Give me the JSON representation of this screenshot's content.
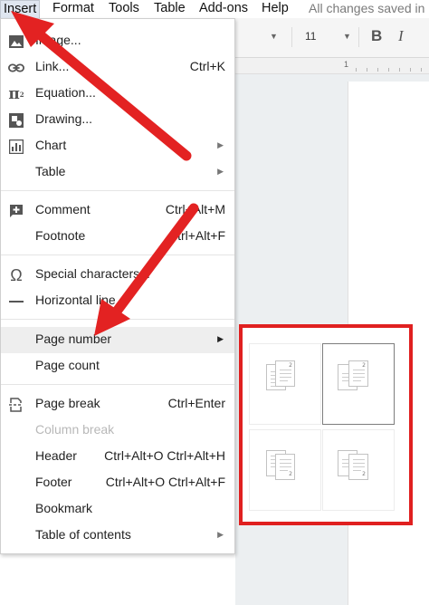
{
  "menubar": {
    "items": [
      "Insert",
      "Format",
      "Tools",
      "Table",
      "Add-ons",
      "Help"
    ],
    "status": "All changes saved in"
  },
  "toolbar": {
    "font_size": "11"
  },
  "ruler": {
    "number": "1"
  },
  "insert_menu": {
    "items": [
      {
        "label": "Image...",
        "icon": "image-icon"
      },
      {
        "label": "Link...",
        "icon": "link-icon",
        "shortcut": "Ctrl+K"
      },
      {
        "label": "Equation...",
        "icon": "pi-icon"
      },
      {
        "label": "Drawing...",
        "icon": "drawing-icon"
      },
      {
        "label": "Chart",
        "icon": "chart-icon",
        "submenu": true
      },
      {
        "label": "Table",
        "submenu": true
      },
      {
        "label": "Comment",
        "icon": "comment-icon",
        "shortcut": "Ctrl+Alt+M"
      },
      {
        "label": "Footnote",
        "shortcut": "Ctrl+Alt+F"
      },
      {
        "label": "Special characters...",
        "icon": "omega-icon"
      },
      {
        "label": "Horizontal line",
        "icon": "horizontal-line-icon"
      },
      {
        "label": "Page number",
        "submenu": true,
        "highlighted": true
      },
      {
        "label": "Page count"
      },
      {
        "label": "Page break",
        "icon": "page-break-icon",
        "shortcut": "Ctrl+Enter"
      },
      {
        "label": "Column break",
        "disabled": true
      },
      {
        "label": "Header",
        "shortcut": "Ctrl+Alt+O Ctrl+Alt+H"
      },
      {
        "label": "Footer",
        "shortcut": "Ctrl+Alt+O Ctrl+Alt+F"
      },
      {
        "label": "Bookmark"
      },
      {
        "label": "Table of contents",
        "submenu": true
      }
    ]
  },
  "page_number_submenu": {
    "options": [
      {
        "position": "top-right",
        "numbers": [
          "1",
          "2"
        ],
        "selected": false
      },
      {
        "position": "top-right-skip-first",
        "numbers": [
          "2"
        ],
        "selected": true
      },
      {
        "position": "bottom-right",
        "numbers": [
          "1",
          "2"
        ],
        "selected": false
      },
      {
        "position": "bottom-right-skip-first",
        "numbers": [
          "2"
        ],
        "selected": false
      }
    ],
    "highlight_color": "#e02020"
  },
  "colors": {
    "arrow": "#e32222",
    "menu_highlight": "#eeeeee",
    "toolbar_bg": "#f5f5f5"
  }
}
